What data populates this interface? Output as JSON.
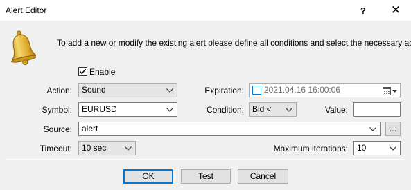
{
  "window": {
    "title": "Alert Editor",
    "help_glyph": "?",
    "close_glyph": "✕"
  },
  "intro_text": "To add a new or modify the existing alert please define all conditions and select the necessary action.",
  "enable": {
    "label": "Enable",
    "checked": true
  },
  "action": {
    "label": "Action:",
    "value": "Sound"
  },
  "expiration": {
    "label": "Expiration:",
    "value": "2021.04.16 16:00:06",
    "checked": false
  },
  "symbol": {
    "label": "Symbol:",
    "value": "EURUSD"
  },
  "condition": {
    "label": "Condition:",
    "value": "Bid <"
  },
  "value_field": {
    "label": "Value:",
    "value": ""
  },
  "source": {
    "label": "Source:",
    "value": "alert",
    "browse_label": "..."
  },
  "timeout": {
    "label": "Timeout:",
    "value": "10 sec"
  },
  "max_iterations": {
    "label": "Maximum iterations:",
    "value": "10"
  },
  "buttons": {
    "ok": "OK",
    "test": "Test",
    "cancel": "Cancel"
  },
  "icons": {
    "bell": "bell-icon",
    "calendar": "calendar-icon"
  },
  "colors": {
    "accent": "#0078d7",
    "dialog_bg": "#f0f0f0",
    "bell": "#d9a520"
  }
}
